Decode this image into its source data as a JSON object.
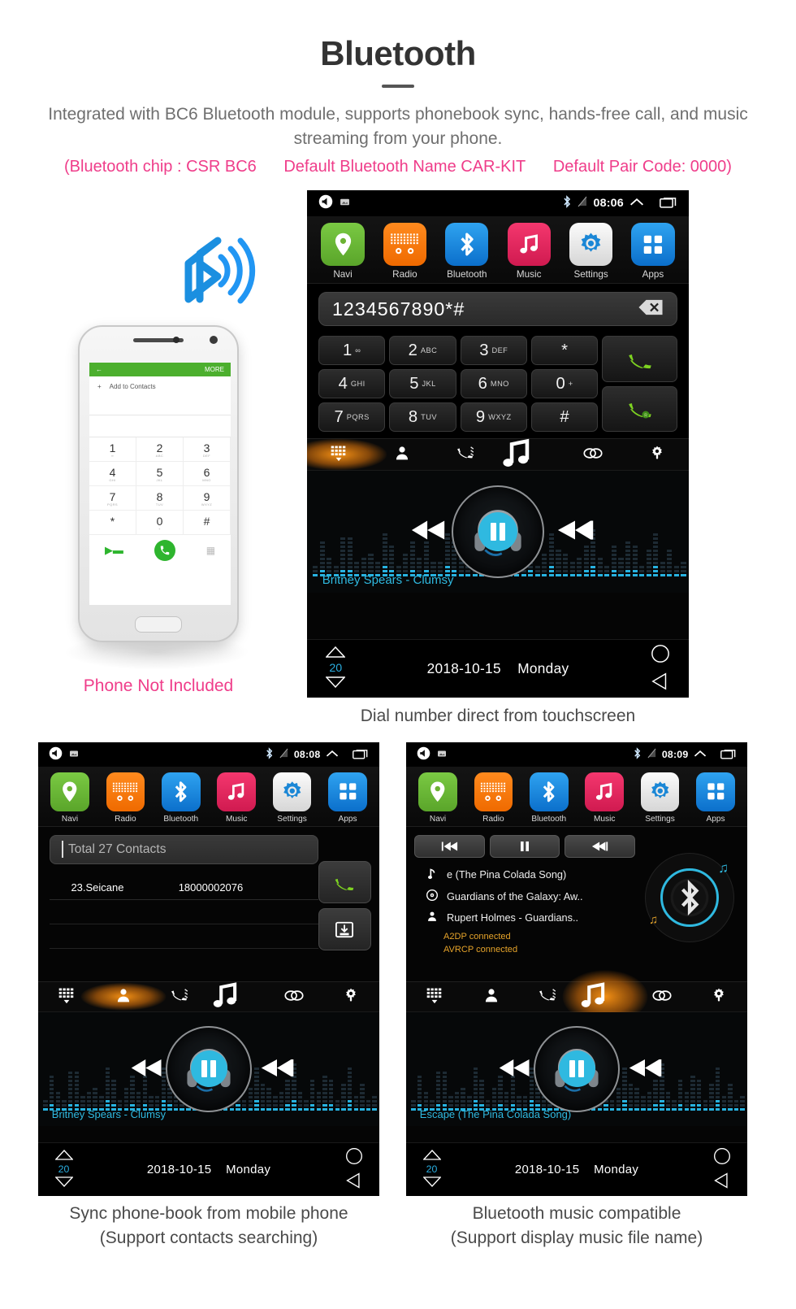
{
  "header": {
    "title": "Bluetooth",
    "subtitle": "Integrated with BC6 Bluetooth module, supports phonebook sync, hands-free call, and music streaming from your phone.",
    "spec_chip": "(Bluetooth chip : CSR BC6",
    "spec_name": "Default Bluetooth Name CAR-KIT",
    "spec_pair": "Default Pair Code: 0000)",
    "accent_pink": "#ef3d8a",
    "text_gray": "#6f6f6f"
  },
  "phone_mock": {
    "top_more": "MORE",
    "add_to_contacts": "Add to Contacts",
    "keys": [
      {
        "n": "1",
        "l": "∞"
      },
      {
        "n": "2",
        "l": "ABC"
      },
      {
        "n": "3",
        "l": "DEF"
      },
      {
        "n": "4",
        "l": "GHI"
      },
      {
        "n": "5",
        "l": "JKL"
      },
      {
        "n": "6",
        "l": "MNO"
      },
      {
        "n": "7",
        "l": "PQRS"
      },
      {
        "n": "8",
        "l": "TUV"
      },
      {
        "n": "9",
        "l": "WXYZ"
      },
      {
        "n": "*",
        "l": ""
      },
      {
        "n": "0",
        "l": "+"
      },
      {
        "n": "#",
        "l": ""
      }
    ],
    "not_included": "Phone Not Included"
  },
  "appbar": {
    "items": [
      {
        "label": "Navi",
        "icon": "location-pin-icon",
        "tile": "tile-navi"
      },
      {
        "label": "Radio",
        "icon": "radio-icon",
        "tile": "tile-radio"
      },
      {
        "label": "Bluetooth",
        "icon": "bluetooth-icon",
        "tile": "tile-bt"
      },
      {
        "label": "Music",
        "icon": "music-note-icon",
        "tile": "tile-music"
      },
      {
        "label": "Settings",
        "icon": "gear-icon",
        "tile": "tile-settings"
      },
      {
        "label": "Apps",
        "icon": "grid-apps-icon",
        "tile": "tile-apps"
      }
    ]
  },
  "tabs": {
    "items": [
      {
        "name": "dialpad-tab",
        "icon": "dialpad-icon"
      },
      {
        "name": "contacts-tab",
        "icon": "person-icon"
      },
      {
        "name": "call-history-tab",
        "icon": "call-history-icon"
      },
      {
        "name": "bt-music-tab",
        "icon": "music-note-icon"
      },
      {
        "name": "link-tab",
        "icon": "link-icon"
      },
      {
        "name": "settings-tab",
        "icon": "gear-icon"
      }
    ]
  },
  "screen_dial": {
    "status": {
      "time": "08:06",
      "bluetooth": "bluetooth-icon",
      "signal": "no-signal-icon"
    },
    "dialed_number": "1234567890*#",
    "backspace": "backspace-icon",
    "keypad": [
      {
        "d": "1",
        "s": "∞"
      },
      {
        "d": "2",
        "s": "ABC"
      },
      {
        "d": "3",
        "s": "DEF"
      },
      {
        "d": "*",
        "s": ""
      },
      {
        "d": "4",
        "s": "GHI"
      },
      {
        "d": "5",
        "s": "JKL"
      },
      {
        "d": "6",
        "s": "MNO"
      },
      {
        "d": "0",
        "s": "+"
      },
      {
        "d": "7",
        "s": "PQRS"
      },
      {
        "d": "8",
        "s": "TUV"
      },
      {
        "d": "9",
        "s": "WXYZ"
      },
      {
        "d": "#",
        "s": ""
      }
    ],
    "call_button": "call-icon",
    "redial_button": "redial-icon",
    "active_tab": 0,
    "player": {
      "track": "Britney Spears - Clumsy",
      "state": "paused"
    },
    "bottom": {
      "volume": "20",
      "date": "2018-10-15",
      "day": "Monday"
    }
  },
  "screen_contacts": {
    "status": {
      "time": "08:08"
    },
    "search_placeholder": "Total 27 Contacts",
    "contacts": [
      {
        "name": "23.Seicane",
        "number": "18000002076"
      }
    ],
    "side_buttons": [
      "call-icon",
      "download-contacts-icon"
    ],
    "active_tab": 1,
    "player": {
      "track": "Britney Spears - Clumsy",
      "state": "paused"
    },
    "bottom": {
      "volume": "20",
      "date": "2018-10-15",
      "day": "Monday"
    }
  },
  "screen_btmusic": {
    "status": {
      "time": "08:09"
    },
    "controls": [
      "prev-track-button",
      "pause-button",
      "next-track-button"
    ],
    "metadata": [
      {
        "icon": "note-icon",
        "text": "e (The Pina Colada Song)"
      },
      {
        "icon": "album-icon",
        "text": "Guardians of the Galaxy: Aw.."
      },
      {
        "icon": "artist-icon",
        "text": "Rupert Holmes - Guardians.."
      }
    ],
    "connections": [
      "A2DP  connected",
      "AVRCP  connected"
    ],
    "active_tab": 3,
    "player": {
      "track": "Escape (The Pina Colada Song)",
      "state": "paused"
    },
    "bottom": {
      "volume": "20",
      "date": "2018-10-15",
      "day": "Monday"
    }
  },
  "captions": {
    "main": "Dial number direct from touchscreen",
    "left_1": "Sync phone-book from mobile phone",
    "left_2": "(Support contacts searching)",
    "right_1": "Bluetooth music compatible",
    "right_2": "(Support display music file name)"
  }
}
